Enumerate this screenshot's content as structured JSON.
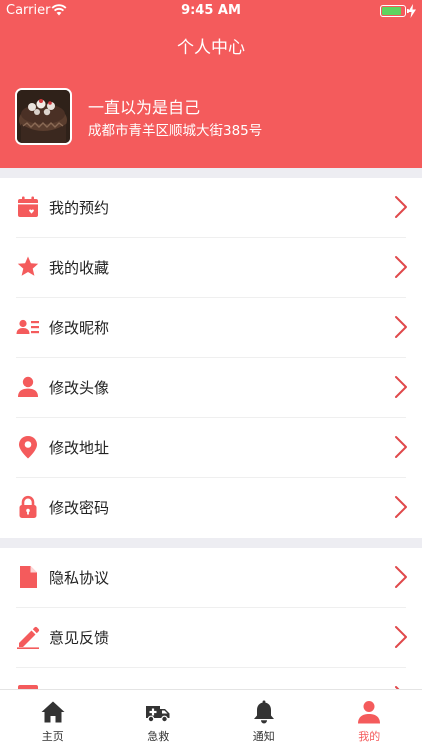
{
  "status_bar": {
    "carrier": "Carrier",
    "time": "9:45 AM",
    "battery_level": 0.85
  },
  "nav": {
    "title": "个人中心"
  },
  "profile": {
    "name": "一直以为是自己",
    "address": "成都市青羊区顺城大街385号"
  },
  "menu_primary": [
    {
      "label": "我的预约",
      "icon": "calendar-heart-icon"
    },
    {
      "label": "我的收藏",
      "icon": "star-icon"
    },
    {
      "label": "修改昵称",
      "icon": "id-card-icon"
    },
    {
      "label": "修改头像",
      "icon": "user-icon"
    },
    {
      "label": "修改地址",
      "icon": "location-pin-icon"
    },
    {
      "label": "修改密码",
      "icon": "lock-icon"
    }
  ],
  "menu_secondary": [
    {
      "label": "隐私协议",
      "icon": "document-icon"
    },
    {
      "label": "意见反馈",
      "icon": "pencil-icon"
    }
  ],
  "tabbar": {
    "items": [
      {
        "label": "主页",
        "icon": "home-icon",
        "active": false
      },
      {
        "label": "急救",
        "icon": "ambulance-icon",
        "active": false
      },
      {
        "label": "通知",
        "icon": "bell-icon",
        "active": false
      },
      {
        "label": "我的",
        "icon": "person-icon",
        "active": true
      }
    ]
  },
  "colors": {
    "accent": "#f45b5c",
    "chevron": "#e0494b",
    "background": "#ededf2"
  }
}
